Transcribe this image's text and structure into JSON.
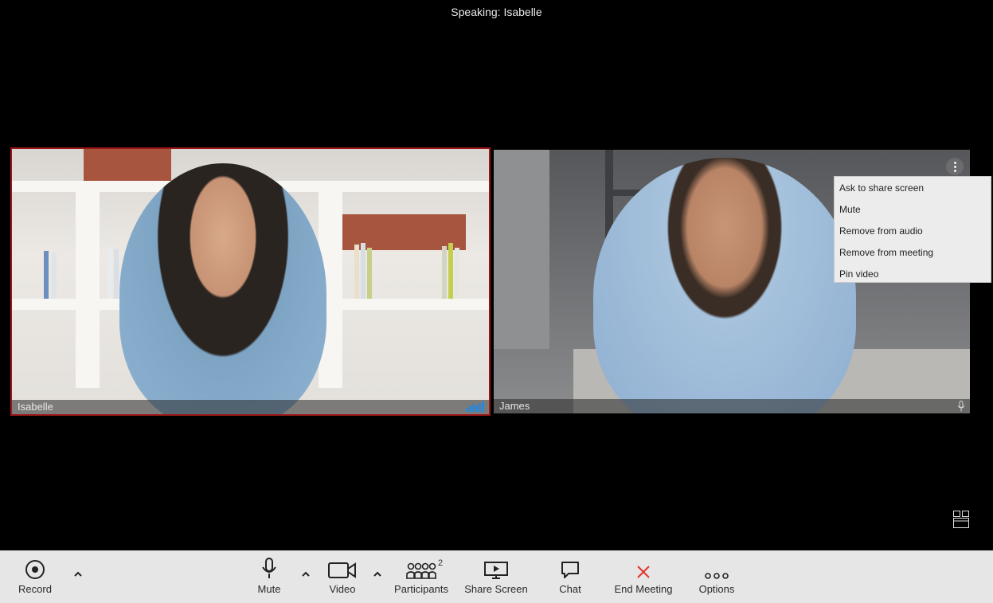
{
  "header": {
    "speaking_text": "Speaking: Isabelle"
  },
  "participants": [
    {
      "name": "Isabelle",
      "active_speaker": true
    },
    {
      "name": "James",
      "active_speaker": false
    }
  ],
  "context_menu": {
    "items": [
      "Ask to share screen",
      "Mute",
      "Remove from audio",
      "Remove from meeting",
      "Pin video"
    ]
  },
  "toolbar": {
    "record_label": "Record",
    "mute_label": "Mute",
    "video_label": "Video",
    "participants_label": "Participants",
    "participants_count": "2",
    "share_label": "Share Screen",
    "chat_label": "Chat",
    "end_label": "End Meeting",
    "options_label": "Options"
  },
  "colors": {
    "active_speaker_border": "#9b1616",
    "audio_level": "#2d86d4",
    "end_meeting_icon": "#e0352b",
    "toolbar_bg": "#e6e6e6"
  }
}
